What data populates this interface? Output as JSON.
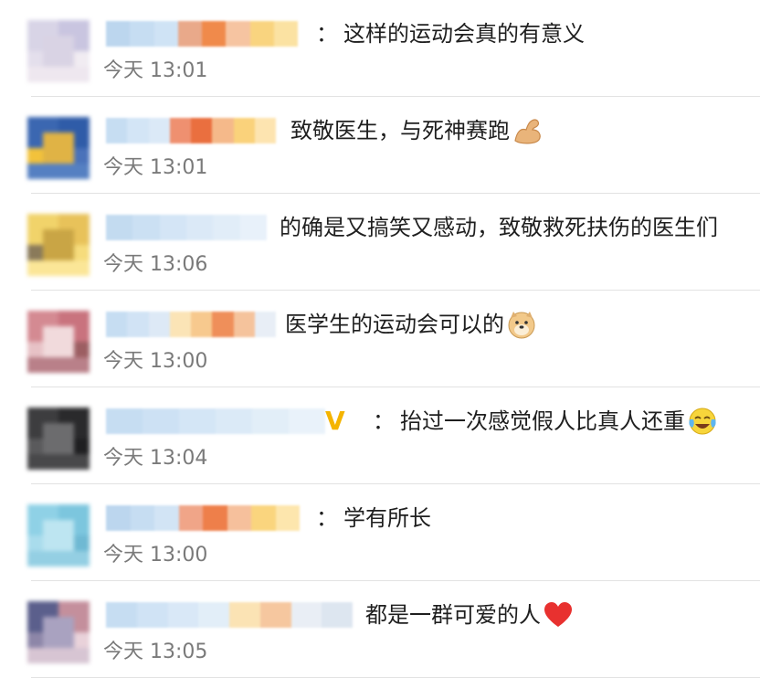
{
  "comments": [
    {
      "separator": "：",
      "text": "这样的运动会真的有意义",
      "time": "今天 13:01",
      "avatar_colors": [
        "#d8d4e6",
        "#c9c5e0",
        "#e4dfec",
        "#f1ecf2",
        "#d9d3e4",
        "#eee7ef"
      ],
      "name_colors": [
        "#bcd6ee",
        "#c6ddf2",
        "#cfe3f5",
        "#e9a98a",
        "#f08a4b",
        "#f6c4a1",
        "#f9d47f",
        "#fbe2a2"
      ],
      "emoji": null
    },
    {
      "separator": "",
      "text": "致敬医生，与死神赛跑",
      "time": "今天 13:01",
      "avatar_colors": [
        "#3b67b1",
        "#2f5ca8",
        "#f2c23b",
        "#4a72ba",
        "#e0b345",
        "#5580c2"
      ],
      "name_colors": [
        "#c6ddf2",
        "#d3e5f6",
        "#dbe9f7",
        "#ef9070",
        "#ea6f3f",
        "#f5b98a",
        "#fad27b",
        "#fde4b0"
      ],
      "emoji": "flexed-biceps"
    },
    {
      "separator": "",
      "text": "的确是又搞笑又感动，致敬救死扶伤的医生们",
      "time": "今天 13:06",
      "avatar_colors": [
        "#f1d36a",
        "#e8c25a",
        "#8a7a5a",
        "#f6dc7c",
        "#c9a545",
        "#fbe697"
      ],
      "name_colors": [
        "#c3dbf0",
        "#cbe0f3",
        "#d4e5f6",
        "#dbe9f7",
        "#e1edf8",
        "#e8f1fa"
      ],
      "emoji": null
    },
    {
      "separator": "",
      "text": "医学生的运动会可以的",
      "time": "今天 13:00",
      "avatar_colors": [
        "#d48a92",
        "#c9737e",
        "#e7c2c6",
        "#9c5e62",
        "#f1dadc",
        "#b98089"
      ],
      "name_colors": [
        "#c6ddf2",
        "#d1e3f5",
        "#dde9f6",
        "#fbe4b6",
        "#f7c98e",
        "#ef8f5a",
        "#f5c39c",
        "#e8eef6"
      ],
      "emoji": "doge"
    },
    {
      "separator": "：",
      "text": "抬过一次感觉假人比真人还重",
      "time": "今天 13:04",
      "avatar_colors": [
        "#3d3d3f",
        "#2a2a2c",
        "#5a5a5c",
        "#1f1f21",
        "#6c6c6e",
        "#48484a"
      ],
      "name_colors": [
        "#c6ddf2",
        "#cde1f4",
        "#d4e6f6",
        "#dbeaf7",
        "#e2eef8",
        "#e9f2fa"
      ],
      "emoji": "laugh-cry",
      "vip": "V"
    },
    {
      "separator": "：",
      "text": "学有所长",
      "time": "今天 13:00",
      "avatar_colors": [
        "#8fd1e6",
        "#7cc6de",
        "#a9dcec",
        "#6fb9d3",
        "#bde5f1",
        "#94cfe3"
      ],
      "name_colors": [
        "#bcd6ee",
        "#c6ddf2",
        "#d2e4f5",
        "#f0a588",
        "#ee7f4a",
        "#f6c09c",
        "#fad57e",
        "#fde6ad"
      ],
      "emoji": null
    },
    {
      "separator": "",
      "text": "都是一群可爱的人",
      "time": "今天 13:05",
      "avatar_colors": [
        "#5b5f8c",
        "#c48f9c",
        "#8d86a8",
        "#e9d2da",
        "#a9a2c0",
        "#d7c5d3"
      ],
      "name_colors": [
        "#c6ddf2",
        "#d0e3f5",
        "#d9e8f7",
        "#e2eef8",
        "#fbe3b4",
        "#f6c79f",
        "#e9eef5",
        "#dde6f0"
      ],
      "emoji": "red-heart"
    }
  ]
}
